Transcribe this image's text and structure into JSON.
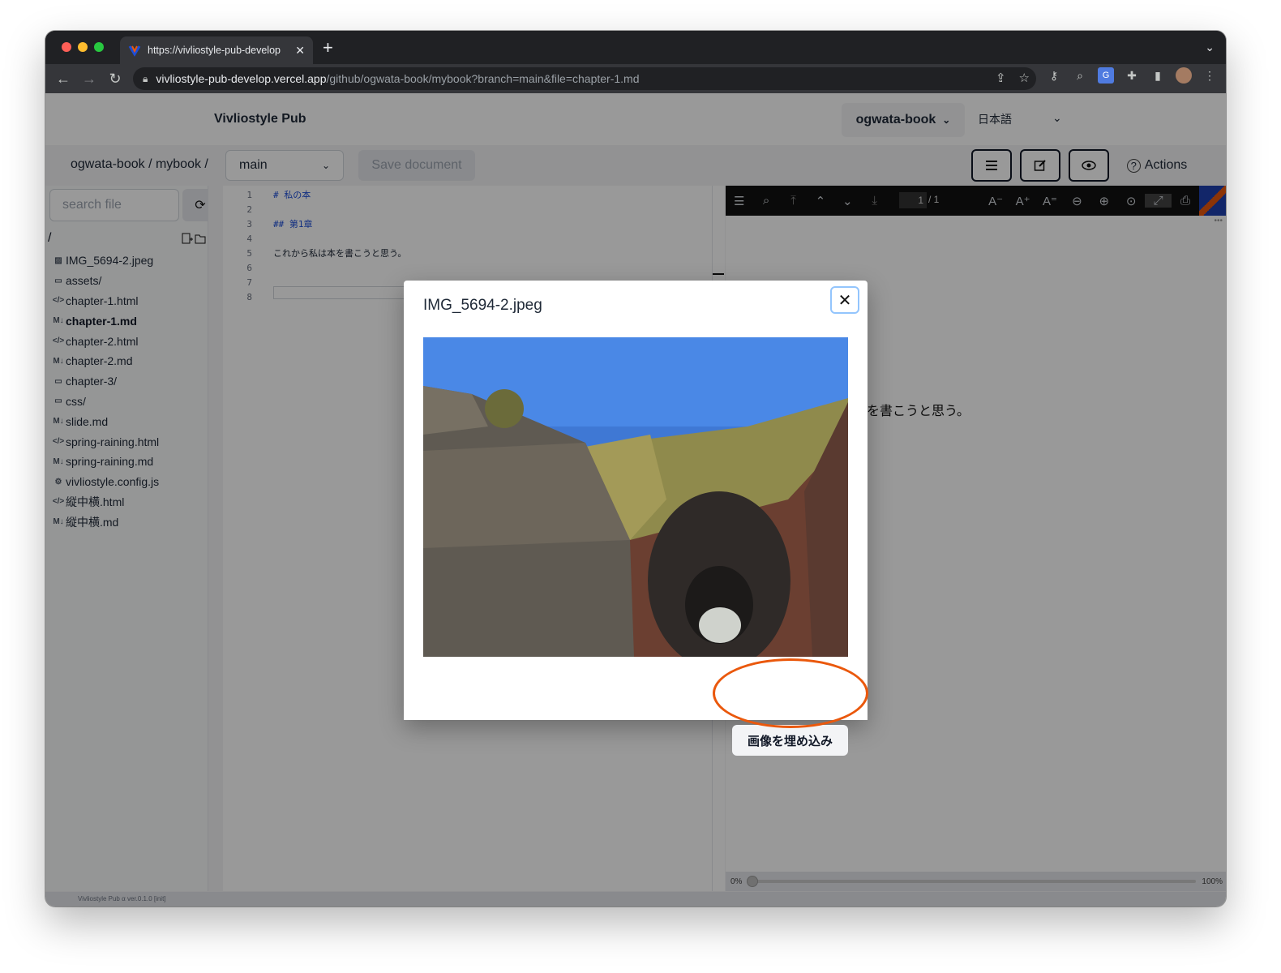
{
  "browser": {
    "tab_title": "https://vivliostyle-pub-develop",
    "url_host": "vivliostyle-pub-develop.vercel.app",
    "url_path": "/github/ogwata-book/mybook?branch=main&file=chapter-1.md"
  },
  "app": {
    "brand": "Vivliostyle Pub",
    "user": "ogwata-book",
    "language": "日本語",
    "breadcrumb": "ogwata-book / mybook /",
    "branch": "main",
    "save_label": "Save document",
    "actions_label": "Actions",
    "footer": "Vivliostyle Pub α ver.0.1.0 [init]"
  },
  "sidebar": {
    "search_placeholder": "search file",
    "root": "/",
    "files": [
      {
        "name": "IMG_5694-2.jpeg",
        "icon": "image-file-icon"
      },
      {
        "name": "assets/",
        "icon": "folder-icon"
      },
      {
        "name": "chapter-1.html",
        "icon": "code-icon"
      },
      {
        "name": "chapter-1.md",
        "icon": "markdown-icon",
        "active": true
      },
      {
        "name": "chapter-2.html",
        "icon": "code-icon"
      },
      {
        "name": "chapter-2.md",
        "icon": "markdown-icon"
      },
      {
        "name": "chapter-3/",
        "icon": "folder-icon"
      },
      {
        "name": "css/",
        "icon": "folder-icon"
      },
      {
        "name": "slide.md",
        "icon": "markdown-icon"
      },
      {
        "name": "spring-raining.html",
        "icon": "code-icon"
      },
      {
        "name": "spring-raining.md",
        "icon": "markdown-icon"
      },
      {
        "name": "vivliostyle.config.js",
        "icon": "gear-icon"
      },
      {
        "name": "縦中横.html",
        "icon": "code-icon"
      },
      {
        "name": "縦中横.md",
        "icon": "markdown-icon"
      }
    ]
  },
  "editor": {
    "lines": [
      {
        "n": "1",
        "text": "# 私の本"
      },
      {
        "n": "2",
        "text": ""
      },
      {
        "n": "3",
        "text": "## 第1章"
      },
      {
        "n": "4",
        "text": ""
      },
      {
        "n": "5",
        "text": "これから私は本を書こうと思う。"
      },
      {
        "n": "6",
        "text": ""
      },
      {
        "n": "7",
        "text": ""
      },
      {
        "n": "8",
        "text": ""
      }
    ]
  },
  "viewer": {
    "page_current": "1",
    "page_total": "/ 1",
    "preview_text": "を書こうと思う。",
    "zoom_min": "0%",
    "zoom_max": "100%",
    "zoom_level": 0.0
  },
  "modal": {
    "title": "IMG_5694-2.jpeg",
    "embed_label": "画像を埋め込み"
  },
  "colors": {
    "accent_ring": "#ea580c"
  }
}
